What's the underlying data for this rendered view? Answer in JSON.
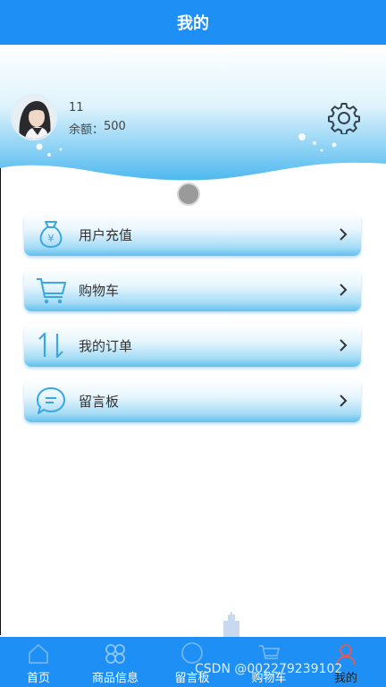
{
  "header": {
    "title": "我的"
  },
  "profile": {
    "user_id": "11",
    "balance_label": "余额：",
    "balance_value": "500"
  },
  "menu": [
    {
      "label": "用户充值",
      "icon": "money-bag-icon"
    },
    {
      "label": "购物车",
      "icon": "cart-icon"
    },
    {
      "label": "我的订单",
      "icon": "sort-arrows-icon"
    },
    {
      "label": "留言板",
      "icon": "chat-bubble-icon"
    }
  ],
  "tabs": [
    {
      "label": "首页",
      "icon": "home-icon"
    },
    {
      "label": "商品信息",
      "icon": "grid-icon"
    },
    {
      "label": "留言板",
      "icon": "chat-icon"
    },
    {
      "label": "购物车",
      "icon": "cart-icon"
    },
    {
      "label": "我的",
      "icon": "user-icon"
    }
  ],
  "watermark": "CSDN @002279239102",
  "colors": {
    "primary": "#1e90f5",
    "menu_accent": "#5fc0ee",
    "icon_blue": "#3aa6e6"
  }
}
